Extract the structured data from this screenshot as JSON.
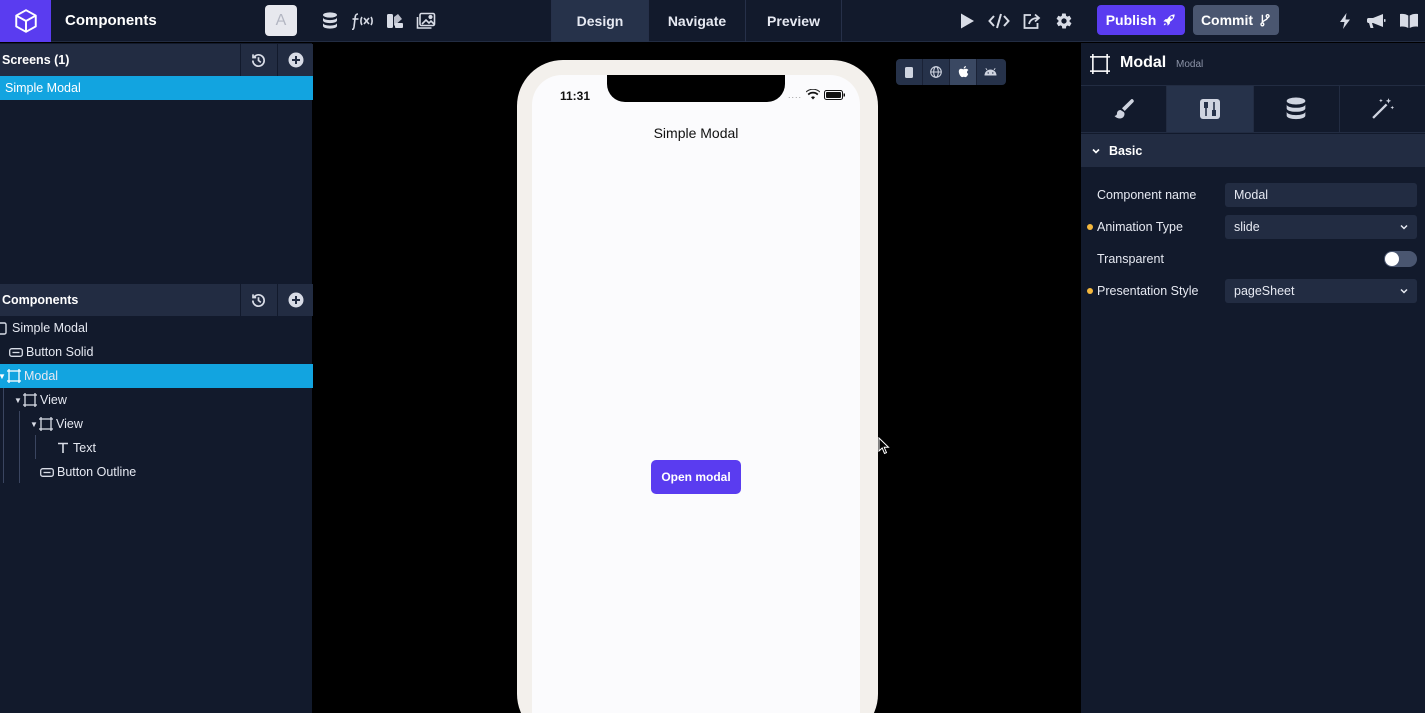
{
  "header": {
    "project_title": "Components",
    "avatar_letter": "A",
    "tabs": [
      {
        "label": "Design"
      },
      {
        "label": "Navigate"
      },
      {
        "label": "Preview"
      }
    ],
    "publish_label": "Publish",
    "commit_label": "Commit"
  },
  "screens": {
    "title": "Screens (1)",
    "items": [
      {
        "label": "Simple Modal"
      }
    ]
  },
  "components": {
    "title": "Components",
    "tree": [
      {
        "label": "Simple Modal"
      },
      {
        "label": "Button Solid"
      },
      {
        "label": "Modal"
      },
      {
        "label": "View"
      },
      {
        "label": "View"
      },
      {
        "label": "Text"
      },
      {
        "label": "Button Outline"
      }
    ]
  },
  "preview": {
    "time": "11:31",
    "screen_title": "Simple Modal",
    "button_label": "Open modal"
  },
  "inspector": {
    "title": "Modal",
    "subtitle": "Modal",
    "section": "Basic",
    "props": {
      "component_name_label": "Component name",
      "component_name_value": "Modal",
      "animation_type_label": "Animation Type",
      "animation_type_value": "slide",
      "transparent_label": "Transparent",
      "presentation_style_label": "Presentation Style",
      "presentation_style_value": "pageSheet"
    }
  },
  "colors": {
    "accent": "#5a3cf0",
    "selection": "#12a4e0",
    "panel_bg": "#121a2c",
    "header_bg": "#222c42"
  }
}
